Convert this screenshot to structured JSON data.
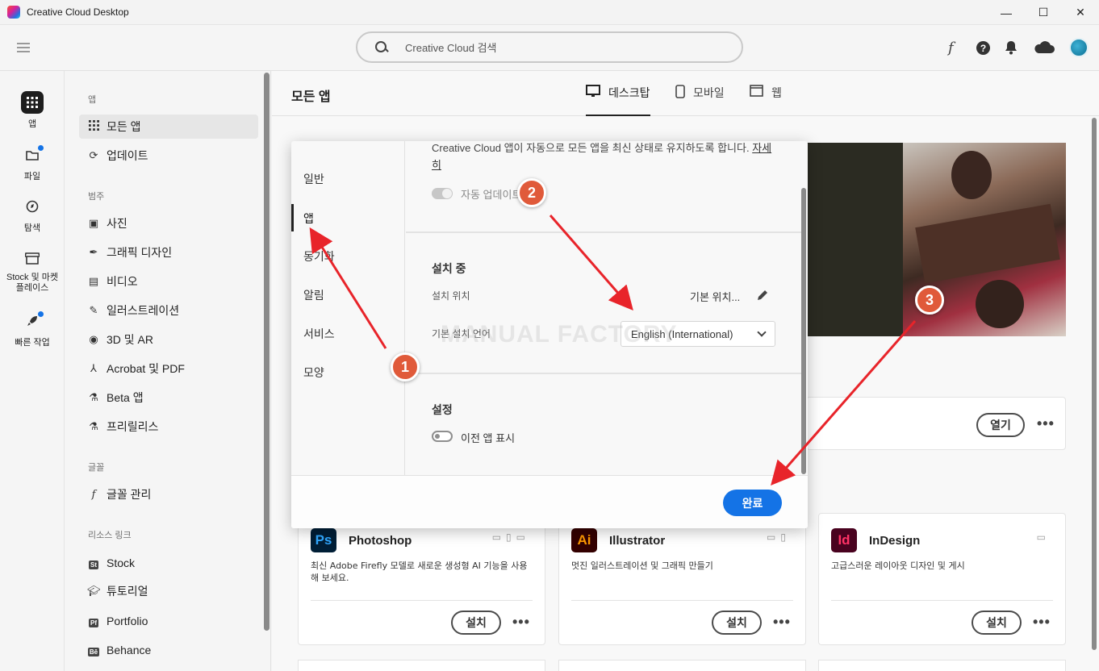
{
  "window": {
    "title": "Creative Cloud Desktop",
    "minimize": "—",
    "maximize": "☐",
    "close": "✕"
  },
  "header": {
    "search_placeholder": "Creative Cloud 검색",
    "font_icon": "f",
    "help_icon": "?",
    "bell_icon": "bell",
    "cloud_icon": "cloud"
  },
  "rail": [
    {
      "label": "앱",
      "icon": "grid-icon"
    },
    {
      "label": "파일",
      "icon": "folder-icon"
    },
    {
      "label": "탐색",
      "icon": "compass-icon"
    },
    {
      "label": "Stock 및 마켓플레이스",
      "icon": "store-icon"
    },
    {
      "label": "빠른 작업",
      "icon": "rocket-icon"
    }
  ],
  "sidebar": {
    "section_apps": "앱",
    "all_apps": "모든 앱",
    "updates": "업데이트",
    "section_categories": "범주",
    "categories": [
      "사진",
      "그래픽 디자인",
      "비디오",
      "일러스트레이션",
      "3D 및 AR",
      "Acrobat 및 PDF",
      "Beta 앱",
      "프리릴리스"
    ],
    "section_fonts": "글꼴",
    "manage_fonts": "글꼴 관리",
    "section_resources": "리소스 링크",
    "resources": [
      "Stock",
      "튜토리얼",
      "Portfolio",
      "Behance"
    ]
  },
  "main": {
    "title": "모든 앱",
    "tabs": [
      "데스크탑",
      "모바일",
      "웹"
    ],
    "open_label": "열기",
    "more": "•••"
  },
  "apps": [
    {
      "code": "Ps",
      "name": "Photoshop",
      "desc": "최신 Adobe Firefly 모델로 새로운 생성형 AI 기능을 사용해 보세요.",
      "action": "설치",
      "color": "#31a8ff",
      "bg": "#001e36"
    },
    {
      "code": "Ai",
      "name": "Illustrator",
      "desc": "멋진 일러스트레이션 및 그래픽 만들기",
      "action": "설치",
      "color": "#ff9a00",
      "bg": "#330000"
    },
    {
      "code": "Id",
      "name": "InDesign",
      "desc": "고급스러운 레이아웃 디자인 및 게시",
      "action": "설치",
      "color": "#ff3366",
      "bg": "#49021f"
    }
  ],
  "modal": {
    "nav": [
      "일반",
      "앱",
      "동기화",
      "알림",
      "서비스",
      "모양"
    ],
    "auto_update_desc": "Creative Cloud 앱이 자동으로 모든 앱을 최신 상태로 유지하도록 합니다.",
    "learn_more": "자세히",
    "auto_update_label": "자동 업데이트",
    "install_header": "설치 중",
    "install_location_label": "설치 위치",
    "install_location_value": "기본 위치...",
    "default_language_label": "기본 설치 언어",
    "default_language_value": "English (International)",
    "settings_header": "설정",
    "show_older_apps": "이전 앱 표시",
    "done": "완료"
  },
  "watermark": "MANUAL FACTORY",
  "annotations": {
    "marker1": "1",
    "marker2": "2",
    "marker3": "3",
    "arrow_color": "#e8242a"
  }
}
